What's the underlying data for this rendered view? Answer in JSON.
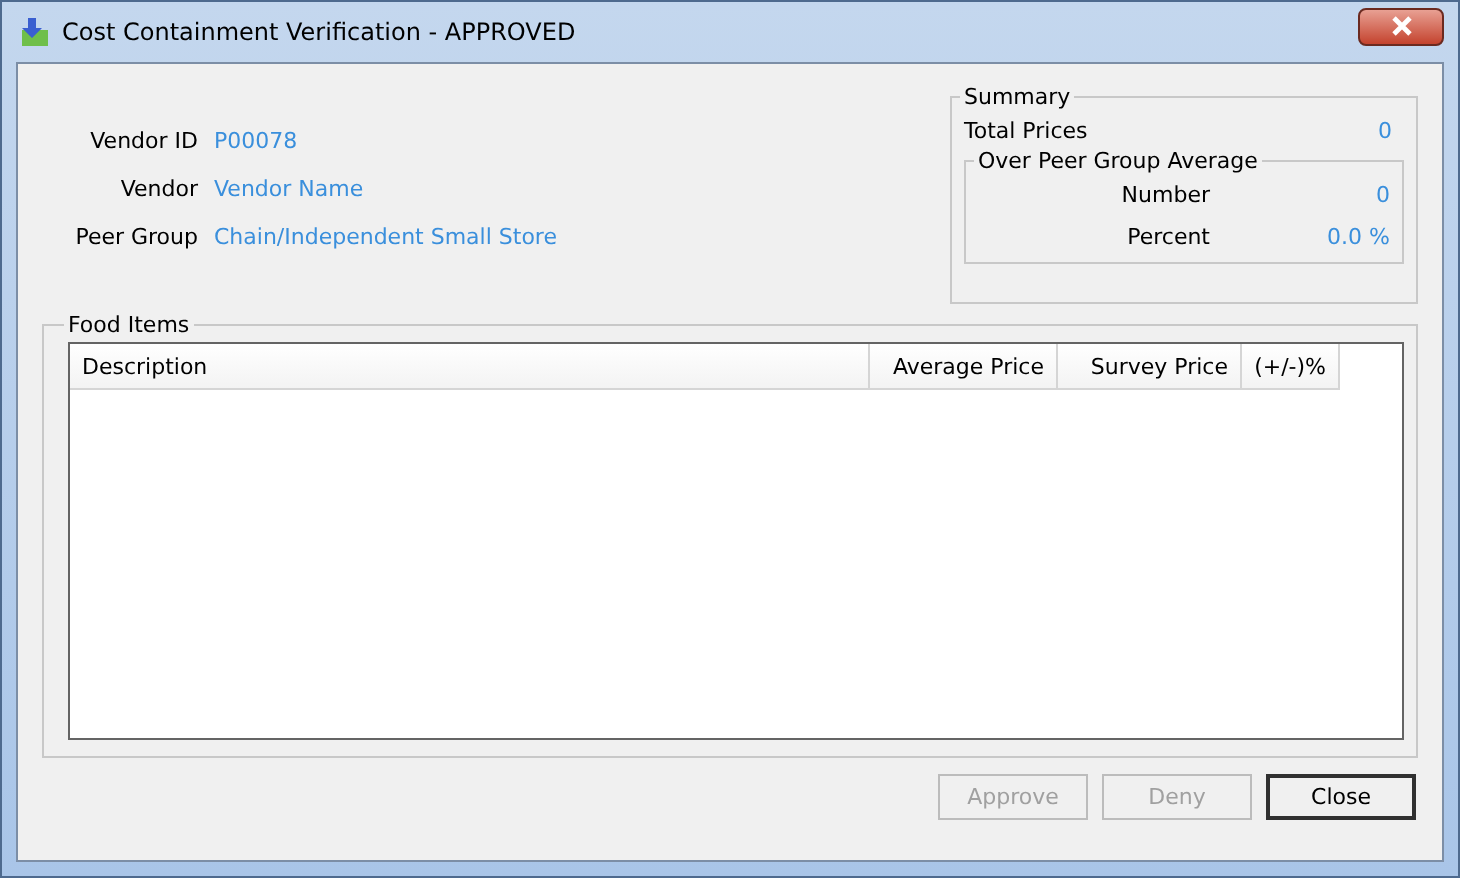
{
  "window": {
    "title": "Cost Containment Verification - APPROVED"
  },
  "vendor_fields": [
    {
      "label": "Vendor ID",
      "value": "P00078"
    },
    {
      "label": "Vendor",
      "value": "Vendor Name"
    },
    {
      "label": "Peer Group",
      "value": "Chain/Independent Small Store"
    }
  ],
  "summary": {
    "title": "Summary",
    "total_label": "Total Prices",
    "total_value": "0",
    "over_peer": {
      "title": "Over Peer Group Average",
      "rows": [
        {
          "label": "Number",
          "value": "0"
        },
        {
          "label": "Percent",
          "value": "0.0 %"
        }
      ]
    }
  },
  "food_items": {
    "title": "Food Items",
    "columns": [
      "Description",
      "Average Price",
      "Survey Price",
      "(+/-)%"
    ]
  },
  "buttons": [
    {
      "label": "Approve",
      "disabled": true,
      "default": false
    },
    {
      "label": "Deny",
      "disabled": true,
      "default": false
    },
    {
      "label": "Close",
      "disabled": false,
      "default": true
    }
  ]
}
